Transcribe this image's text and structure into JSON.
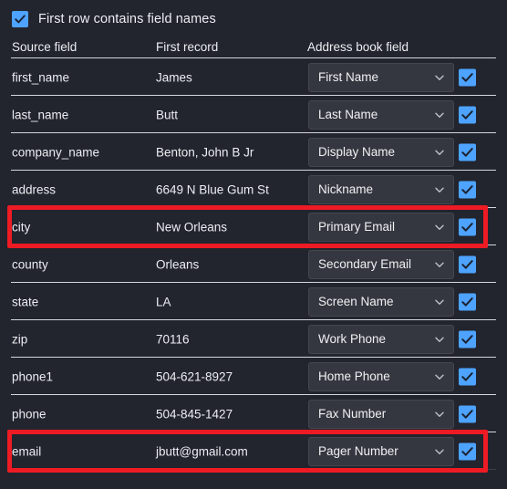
{
  "options": {
    "first_row_header": {
      "label": "First row contains field names",
      "checked": true
    }
  },
  "table": {
    "headers": {
      "source_field": "Source field",
      "first_record": "First record",
      "address_book_field": "Address book field"
    },
    "rows": [
      {
        "source": "first_name",
        "record": "James",
        "mapping": "First Name",
        "enabled": true,
        "highlighted": false
      },
      {
        "source": "last_name",
        "record": "Butt",
        "mapping": "Last Name",
        "enabled": true,
        "highlighted": false
      },
      {
        "source": "company_name",
        "record": "Benton, John B Jr",
        "mapping": "Display Name",
        "enabled": true,
        "highlighted": false
      },
      {
        "source": "address",
        "record": "6649 N Blue Gum St",
        "mapping": "Nickname",
        "enabled": true,
        "highlighted": false
      },
      {
        "source": "city",
        "record": "New Orleans",
        "mapping": "Primary Email",
        "enabled": true,
        "highlighted": true
      },
      {
        "source": "county",
        "record": "Orleans",
        "mapping": "Secondary Email",
        "enabled": true,
        "highlighted": false
      },
      {
        "source": "state",
        "record": "LA",
        "mapping": "Screen Name",
        "enabled": true,
        "highlighted": false
      },
      {
        "source": "zip",
        "record": "70116",
        "mapping": "Work Phone",
        "enabled": true,
        "highlighted": false
      },
      {
        "source": "phone1",
        "record": "504-621-8927",
        "mapping": "Home Phone",
        "enabled": true,
        "highlighted": false
      },
      {
        "source": "phone",
        "record": "504-845-1427",
        "mapping": "Fax Number",
        "enabled": true,
        "highlighted": false
      },
      {
        "source": "email",
        "record": "jbutt@gmail.com",
        "mapping": "Pager Number",
        "enabled": true,
        "highlighted": true
      }
    ]
  },
  "icons": {
    "checkmark": "check-icon",
    "dropdown_arrow": "chevron-down-icon"
  },
  "colors": {
    "background": "#22242e",
    "accent": "#4da3ff",
    "highlight": "#ee1b24",
    "dropdown_bg": "#34373f",
    "separator": "#e4e6ea",
    "text": "#eceef2"
  }
}
